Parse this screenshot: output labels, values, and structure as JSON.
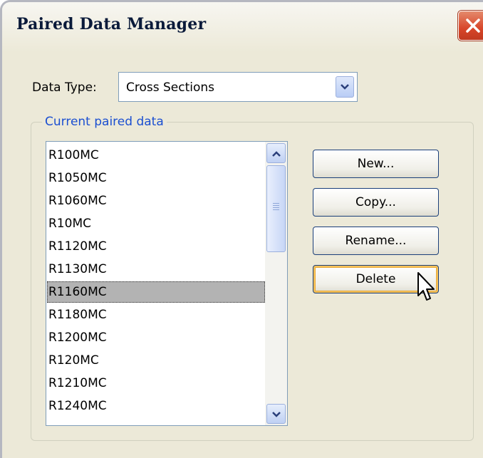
{
  "window": {
    "title": "Paired Data Manager"
  },
  "data_type": {
    "label": "Data Type:",
    "selected": "Cross Sections"
  },
  "group": {
    "legend": "Current paired data"
  },
  "list": {
    "items": [
      "R100MC",
      "R1050MC",
      "R1060MC",
      "R10MC",
      "R1120MC",
      "R1130MC",
      "R1160MC",
      "R1180MC",
      "R1200MC",
      "R120MC",
      "R1210MC",
      "R1240MC"
    ],
    "selected": "R1160MC"
  },
  "buttons": {
    "new": "New...",
    "copy": "Copy...",
    "rename": "Rename...",
    "delete": "Delete"
  },
  "icons": {
    "close": "close-icon",
    "dropdown": "chevron-down-icon",
    "scroll_up": "chevron-up-icon",
    "scroll_down": "chevron-down-icon",
    "cursor": "mouse-pointer-icon"
  },
  "colors": {
    "legend": "#1b4fd1",
    "close_button": "#d8462a",
    "selection": "#b3b3b3"
  }
}
